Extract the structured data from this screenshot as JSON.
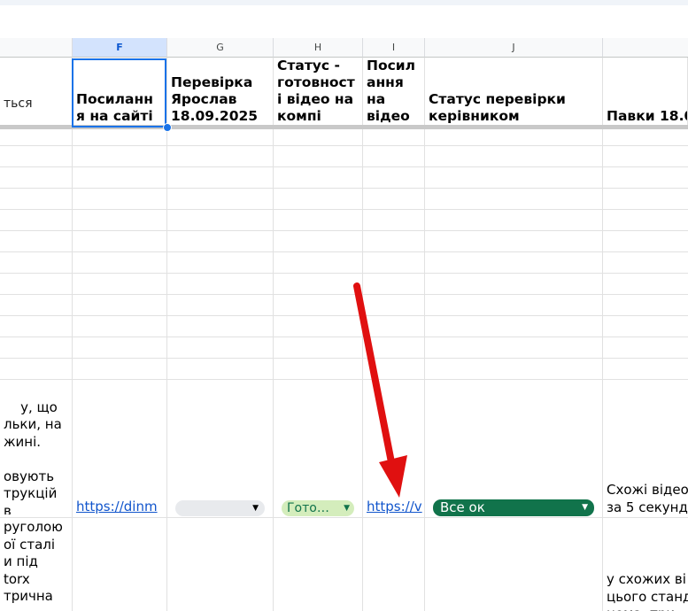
{
  "columns": [
    {
      "letter": "F",
      "selected": true
    },
    {
      "letter": "G"
    },
    {
      "letter": "H"
    },
    {
      "letter": "I"
    },
    {
      "letter": "J"
    }
  ],
  "headers": {
    "e": "ться",
    "f": "Посиланн\nя на сайті",
    "g": "Перевірка\nЯрослав\n18.09.2025",
    "h": "Статус -\nготовност\nі відео на\nкомпі",
    "i": "Посил\nання\nна\nвідео",
    "j": "Статус перевірки\nкерівником",
    "k": "Павки 18.0"
  },
  "row1": {
    "e_text": "у, що\nльки, на\nжині.\n\nовують\nтрукцій в\nожна",
    "e_link": "а",
    "f_link": "https://dinm",
    "h_chip": "Гото…",
    "i_link": "https://v",
    "j_chip": "Все ок",
    "k_text": "Схожі відео\nза 5 секунд"
  },
  "row2": {
    "e_text": "руголою\nої сталі\nи під torx\nтрична",
    "k_text": "у схожих ві\nцього станд\nнема  три"
  },
  "colors": {
    "chip_green_light": "#d4edbc",
    "chip_green_dark": "#11734b",
    "chip_gray": "#e8eaed",
    "arrow_red": "#e01010",
    "selection": "#1a73e8"
  }
}
